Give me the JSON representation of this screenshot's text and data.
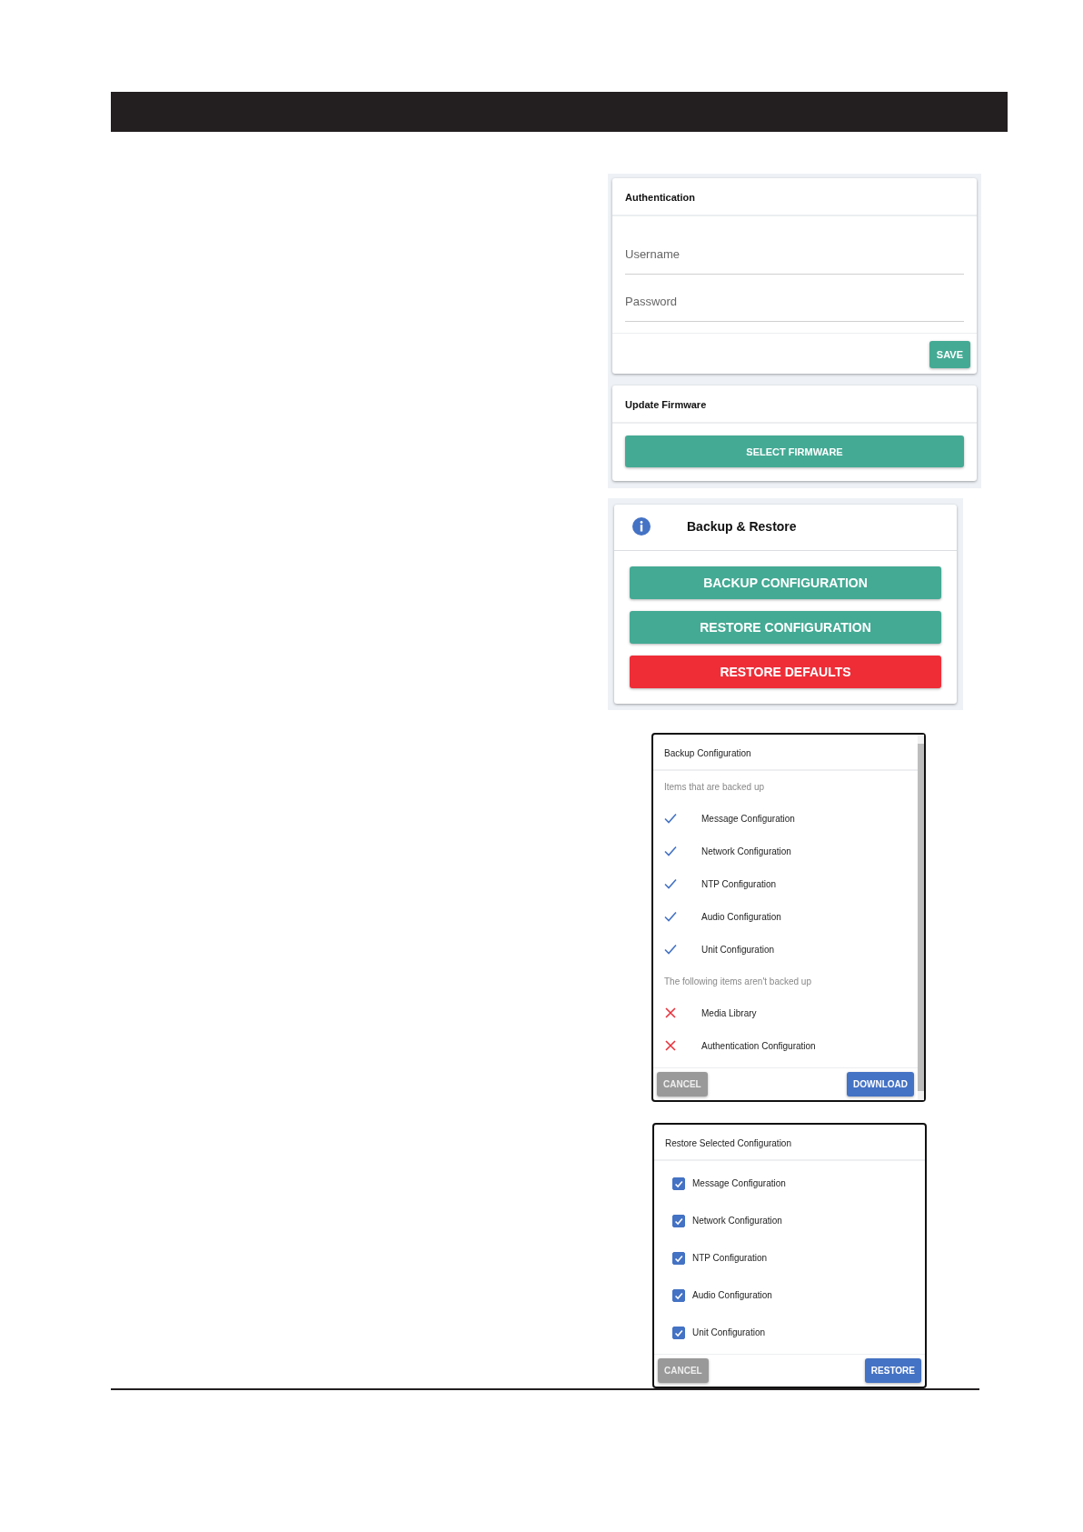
{
  "authentication": {
    "title": "Authentication",
    "fields": [
      {
        "placeholder": "Username"
      },
      {
        "placeholder": "Password"
      }
    ],
    "button": "SAVE"
  },
  "firmware": {
    "title": "Update Firmware",
    "button": "SELECT FIRMWARE"
  },
  "backup_restore": {
    "title": "Backup & Restore",
    "buttons": [
      {
        "label": "BACKUP CONFIGURATION",
        "kind": "primary"
      },
      {
        "label": "RESTORE CONFIGURATION",
        "kind": "primary"
      },
      {
        "label": "RESTORE DEFAULTS",
        "kind": "danger"
      }
    ]
  },
  "backup_dialog": {
    "title": "Backup Configuration",
    "sections": [
      {
        "heading": "Items that are backed up",
        "items": [
          {
            "label": "Message Configuration",
            "included": true
          },
          {
            "label": "Network Configuration",
            "included": true
          },
          {
            "label": "NTP Configuration",
            "included": true
          },
          {
            "label": "Audio Configuration",
            "included": true
          },
          {
            "label": "Unit Configuration",
            "included": true
          }
        ]
      },
      {
        "heading": "The following items aren't backed up",
        "items": [
          {
            "label": "Media Library",
            "included": false
          },
          {
            "label": "Authentication Configuration",
            "included": false
          }
        ]
      }
    ],
    "buttons": [
      {
        "label": "CANCEL",
        "kind": "secondary"
      },
      {
        "label": "DOWNLOAD",
        "kind": "primary"
      }
    ]
  },
  "restore_dialog": {
    "title": "Restore Selected Configuration",
    "items": [
      {
        "label": "Message Configuration",
        "checked": true
      },
      {
        "label": "Network Configuration",
        "checked": true
      },
      {
        "label": "NTP Configuration",
        "checked": true
      },
      {
        "label": "Audio Configuration",
        "checked": true
      },
      {
        "label": "Unit Configuration",
        "checked": true
      }
    ],
    "buttons": [
      {
        "label": "CANCEL",
        "kind": "secondary"
      },
      {
        "label": "RESTORE",
        "kind": "primary"
      }
    ]
  }
}
